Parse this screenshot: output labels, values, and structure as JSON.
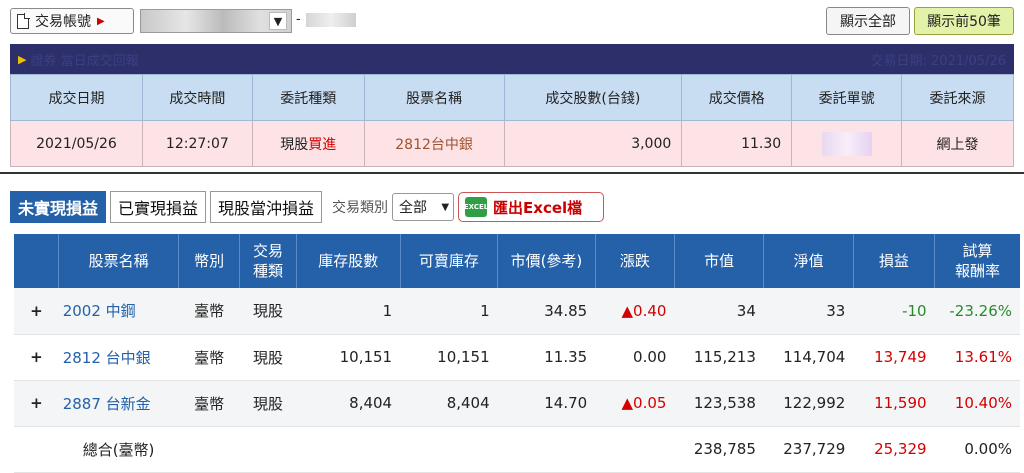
{
  "toolbar": {
    "account_label": "交易帳號",
    "dash": "-",
    "show_all": "顯示全部",
    "show_50": "顯示前50筆"
  },
  "trade": {
    "title": "證券 當日成交回報",
    "date_text": "交易日期: 2021/05/26",
    "headers": [
      "成交日期",
      "成交時間",
      "委託種類",
      "股票名稱",
      "成交股數(台錢)",
      "成交價格",
      "委託單號",
      "委託來源"
    ],
    "row": {
      "date": "2021/05/26",
      "time": "12:27:07",
      "kind_prefix": "現股",
      "kind_action": "買進",
      "stock": "2812台中銀",
      "shares": "3,000",
      "price": "11.30",
      "source": "網上發"
    }
  },
  "pl": {
    "tabs": [
      "未實現損益",
      "已實現損益",
      "現股當沖損益"
    ],
    "type_label": "交易類別",
    "type_value": "全部",
    "excel_icon": "EXCEL",
    "excel_label": "匯出Excel檔",
    "headers": [
      "股票名稱",
      "幣別",
      "交易\n種類",
      "庫存股數",
      "可賣庫存",
      "市價(參考)",
      "漲跌",
      "市值",
      "淨值",
      "損益",
      "試算\n報酬率"
    ],
    "rows": [
      {
        "expand": "+",
        "stock": "2002 中鋼",
        "currency": "臺幣",
        "kind": "現股",
        "shares": "1",
        "sellable": "1",
        "price": "34.85",
        "change": "▲0.40",
        "market": "34",
        "net": "33",
        "pl": "-10",
        "ret": "-23.26%"
      },
      {
        "expand": "+",
        "stock": "2812 台中銀",
        "currency": "臺幣",
        "kind": "現股",
        "shares": "10,151",
        "sellable": "10,151",
        "price": "11.35",
        "change": "0.00",
        "market": "115,213",
        "net": "114,704",
        "pl": "13,749",
        "ret": "13.61%"
      },
      {
        "expand": "+",
        "stock": "2887 台新金",
        "currency": "臺幣",
        "kind": "現股",
        "shares": "8,404",
        "sellable": "8,404",
        "price": "14.70",
        "change": "▲0.05",
        "market": "123,538",
        "net": "122,992",
        "pl": "11,590",
        "ret": "10.40%"
      }
    ],
    "total": {
      "label": "總合(臺幣)",
      "market": "238,785",
      "net": "237,729",
      "pl": "25,329",
      "ret": "0.00%"
    }
  },
  "colors": {
    "header_blue": "#2461a8",
    "trade_header": "#c9ddf2",
    "trade_row": "#fde3e6",
    "up_red": "#d40000",
    "down_green": "#2a8a2a"
  }
}
